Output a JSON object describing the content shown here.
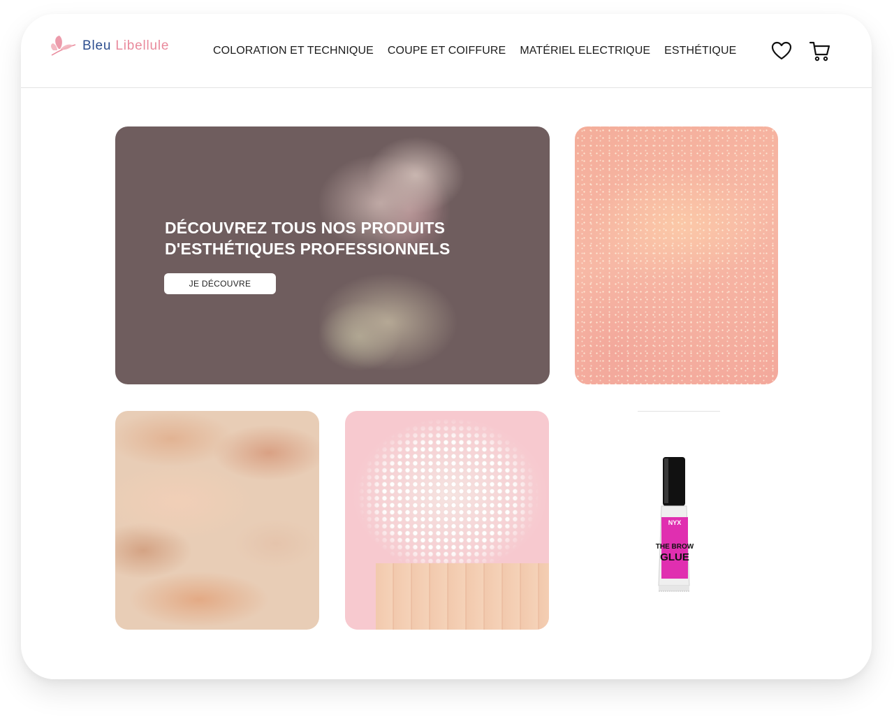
{
  "brand": {
    "name_part1": "Bleu",
    "name_part2": "Libellule",
    "logo_icon": "dragonfly-icon",
    "colors": {
      "blue": "#2c4d8e",
      "pink": "#e98a9c"
    }
  },
  "nav": {
    "items": [
      {
        "label": "COLORATION ET TECHNIQUE"
      },
      {
        "label": "COUPE ET COIFFURE"
      },
      {
        "label": "MATÉRIEL ELECTRIQUE"
      },
      {
        "label": "ESTHÉTIQUE"
      }
    ],
    "icons": [
      "heart-icon",
      "cart-icon"
    ]
  },
  "hero": {
    "title": "DÉCOUVREZ TOUS NOS PRODUITS\nD'ESTHÉTIQUES PROFESSIONNELS",
    "button_label": "JE DÉCOUVRE",
    "overlay_color": "#6f5d5e"
  },
  "product": {
    "brand": "NYX",
    "name_line1": "THE BROW",
    "name_line2": "GLUE",
    "accent": "#e02fb0"
  }
}
